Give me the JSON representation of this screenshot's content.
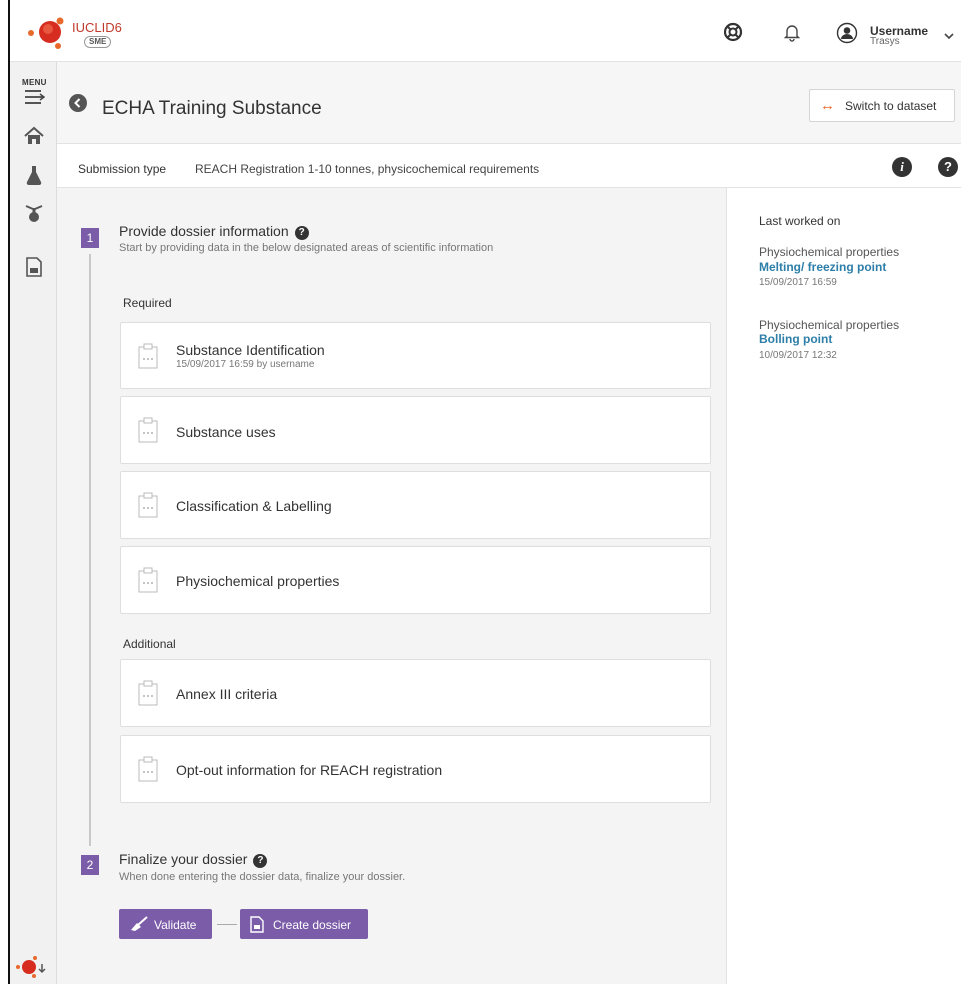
{
  "header": {
    "logo_text": "IUCLID6",
    "logo_sub": "SME",
    "user_name": "Username",
    "user_org": "Trasys"
  },
  "sidebar": {
    "menu_label": "MENU"
  },
  "titlebar": {
    "title": "ECHA Training Substance",
    "switch_label": "Switch to dataset"
  },
  "submission": {
    "label": "Submission type",
    "value": "REACH Registration 1-10 tonnes, physicochemical requirements"
  },
  "step1": {
    "number": "1",
    "title": "Provide dossier information",
    "subtitle": "Start by  providing data in the below designated areas of scientific information",
    "required_label": "Required",
    "additional_label": "Additional",
    "required_items": [
      {
        "title": "Substance Identification",
        "meta": "15/09/2017 16:59 by username"
      },
      {
        "title": "Substance uses",
        "meta": ""
      },
      {
        "title": "Classification & Labelling",
        "meta": ""
      },
      {
        "title": "Physiochemical properties",
        "meta": ""
      }
    ],
    "additional_items": [
      {
        "title": "Annex III criteria",
        "meta": ""
      },
      {
        "title": "Opt-out information for REACH registration",
        "meta": ""
      }
    ]
  },
  "step2": {
    "number": "2",
    "title": "Finalize your dossier",
    "subtitle": "When done entering the dossier data,  finalize your dossier.",
    "validate_label": "Validate",
    "create_label": "Create dossier"
  },
  "last_worked": {
    "title": "Last worked on",
    "items": [
      {
        "category": "Physiochemical properties",
        "link": "Melting/ freezing point",
        "time": "15/09/2017 16:59"
      },
      {
        "category": "Physiochemical properties",
        "link": "Bolling point",
        "time": "10/09/2017 12:32"
      }
    ]
  },
  "colors": {
    "accent": "#7b5ca8",
    "link": "#2d7ea8",
    "switch_icon": "#e8692c"
  }
}
